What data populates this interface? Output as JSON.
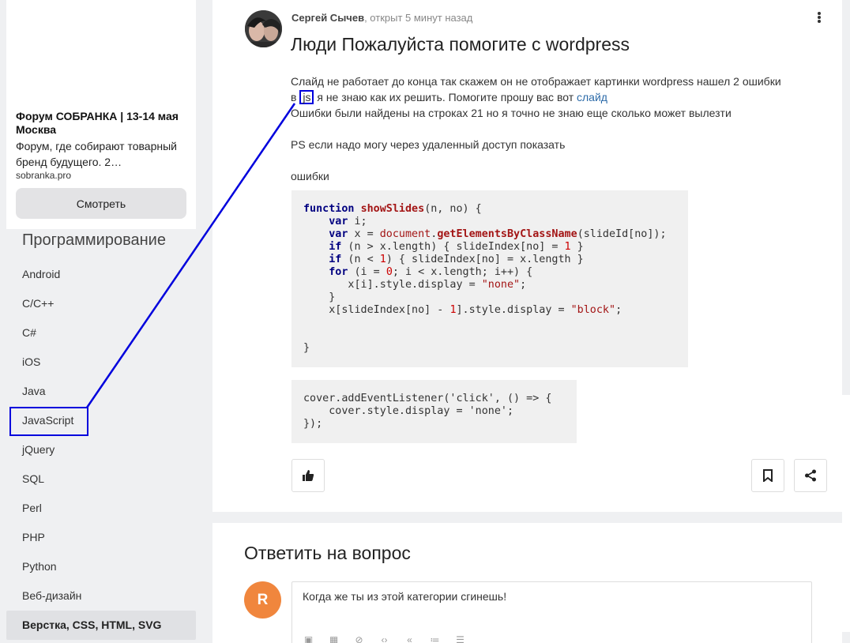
{
  "sidebar": {
    "ad": {
      "title": "Форум СОБРАНКА | 13-14 мая Москва",
      "description": "Форум, где собирают товарный бренд будущего. 2…",
      "domain": "sobranka.pro",
      "button_label": "Смотреть"
    },
    "categories_heading": "Программирование",
    "categories": [
      {
        "label": "Android"
      },
      {
        "label": "C/C++"
      },
      {
        "label": "C#"
      },
      {
        "label": "iOS"
      },
      {
        "label": "Java"
      },
      {
        "label": "JavaScript"
      },
      {
        "label": "jQuery"
      },
      {
        "label": "SQL"
      },
      {
        "label": "Perl"
      },
      {
        "label": "PHP"
      },
      {
        "label": "Python"
      },
      {
        "label": "Веб-дизайн"
      },
      {
        "label": "Верстка, CSS, HTML, SVG"
      }
    ]
  },
  "question": {
    "author": "Сергей Сычев",
    "meta": ", открыт 5 минут назад",
    "title": "Люди Пожалуйста помогите с wordpress",
    "body": {
      "line1": "Слайд не работает до конца так скажем он не отображает картинки wordpress нашел 2 ошибки",
      "line2_pre": "в ",
      "js_tag": "js",
      "line2_post": " я не знаю как их решить. Помогите прошу вас вот ",
      "link": "слайд",
      "line3": "Ошибки были найдены на строках 21 но я точно не знаю еще сколько может вылезти",
      "line4": "PS если надо могу через удаленный доступ показать",
      "line5": "ошибки"
    }
  },
  "answer": {
    "heading": "Ответить на вопрос",
    "avatar_letter": "R",
    "reply_text": "Когда же ты из этой категории сгинешь!"
  },
  "colors": {
    "highlight": "#0000dd",
    "avatar_orange": "#f0863d",
    "link": "#2b6aa8"
  }
}
